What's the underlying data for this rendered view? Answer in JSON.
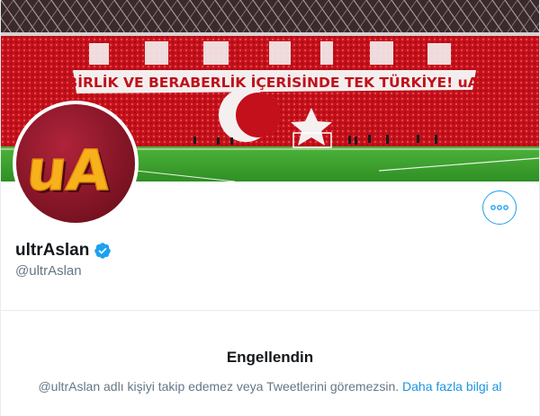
{
  "banner": {
    "top_text": "TÜRKİYE",
    "slogan": "BİRLİK VE BERABERLİK İÇERİSİNDE TEK TÜRKİYE! uA",
    "colors": {
      "red": "#d0101a",
      "grass": "#3fa62e",
      "stand": "#b3121c"
    }
  },
  "avatar": {
    "logo_text": "uA",
    "bg_color": "#8c1827",
    "logo_color": "#f7b21b"
  },
  "profile": {
    "display_name": "ultrAslan",
    "handle": "@ultrAslan",
    "verified_icon": "verified-badge-icon",
    "more_icon": "more-options-icon"
  },
  "blocked": {
    "title": "Engellendin",
    "message": "@ultrAslan adlı kişiyi takip edemez veya Tweetlerini göremezsin.",
    "learn_more": "Daha fazla bilgi al"
  },
  "colors": {
    "accent": "#1da1f2",
    "text_primary": "#14171a",
    "text_secondary": "#657786"
  }
}
